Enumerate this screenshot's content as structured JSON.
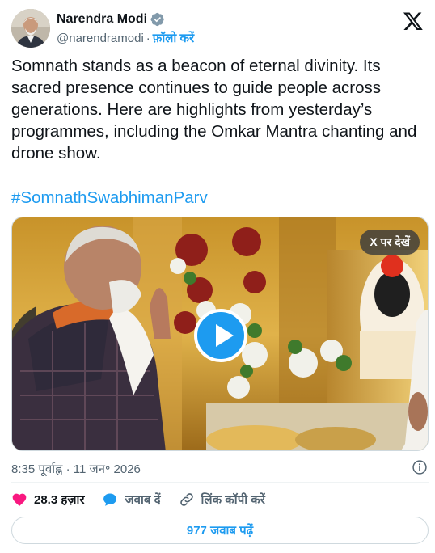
{
  "author": {
    "name": "Narendra Modi",
    "handle": "@narendramodi",
    "separator": "·",
    "follow_label": "फ़ॉलो करें"
  },
  "tweet": {
    "text": "Somnath stands as a beacon of eternal divinity. Its sacred presence continues to guide people across generations. Here are highlights from yesterday’s programmes, including the Omkar Mantra chanting and drone show.",
    "hashtag": "#SomnathSwabhimanParv"
  },
  "media": {
    "view_on_x_label": "X पर देखें"
  },
  "meta": {
    "timestamp": "8:35 पूर्वाह्न · 11 जन॰ 2026"
  },
  "actions": {
    "likes": "28.3 हज़ार",
    "reply_label": "जवाब दें",
    "copy_link_label": "लिंक कॉपी करें"
  },
  "replies_button": {
    "label": "977 जवाब पढ़ें"
  },
  "colors": {
    "accent": "#1d9bf0",
    "like": "#f91880",
    "text": "#0f1419",
    "muted": "#536471"
  }
}
